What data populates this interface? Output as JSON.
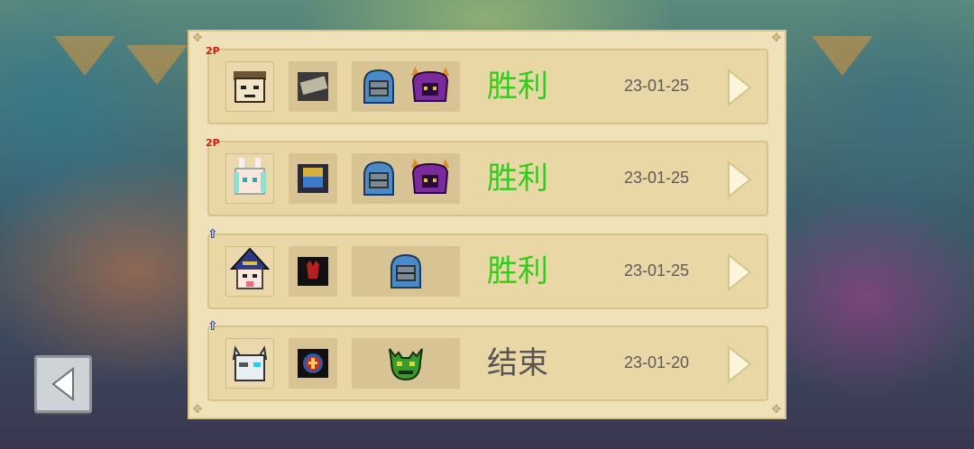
{
  "colors": {
    "victory": "#33cc1a",
    "ended": "#555555",
    "panel": "#f0e2b8",
    "row": "#ead7a6"
  },
  "back_button": {
    "icon": "back-arrow-icon"
  },
  "records": [
    {
      "mode_tag": "2P",
      "mode_icon": "two-player-icon",
      "hero_icon": "bald-hero-portrait-icon",
      "weapon_icon": "cash-weapon-icon",
      "boss_icons": [
        "knight-helmet-icon",
        "horned-helmet-icon"
      ],
      "result": "胜利",
      "result_type": "victory",
      "date": "23-01-25"
    },
    {
      "mode_tag": "2P",
      "mode_icon": "two-player-icon",
      "hero_icon": "bunny-girl-portrait-icon",
      "weapon_icon": "pixel-gadget-weapon-icon",
      "boss_icons": [
        "knight-helmet-icon",
        "horned-helmet-icon"
      ],
      "result": "胜利",
      "result_type": "victory",
      "date": "23-01-25"
    },
    {
      "mode_tag": "⇧",
      "mode_icon": "upgrade-arrow-icon",
      "hero_icon": "wizard-portrait-icon",
      "weapon_icon": "red-demon-weapon-icon",
      "boss_icons": [
        "knight-helmet-icon"
      ],
      "result": "胜利",
      "result_type": "victory",
      "date": "23-01-25"
    },
    {
      "mode_tag": "⇧",
      "mode_icon": "upgrade-arrow-icon",
      "hero_icon": "robot-cat-portrait-icon",
      "weapon_icon": "cross-shield-weapon-icon",
      "boss_icons": [
        "goblin-mask-icon"
      ],
      "result": "结束",
      "result_type": "ended",
      "date": "23-01-20"
    }
  ]
}
